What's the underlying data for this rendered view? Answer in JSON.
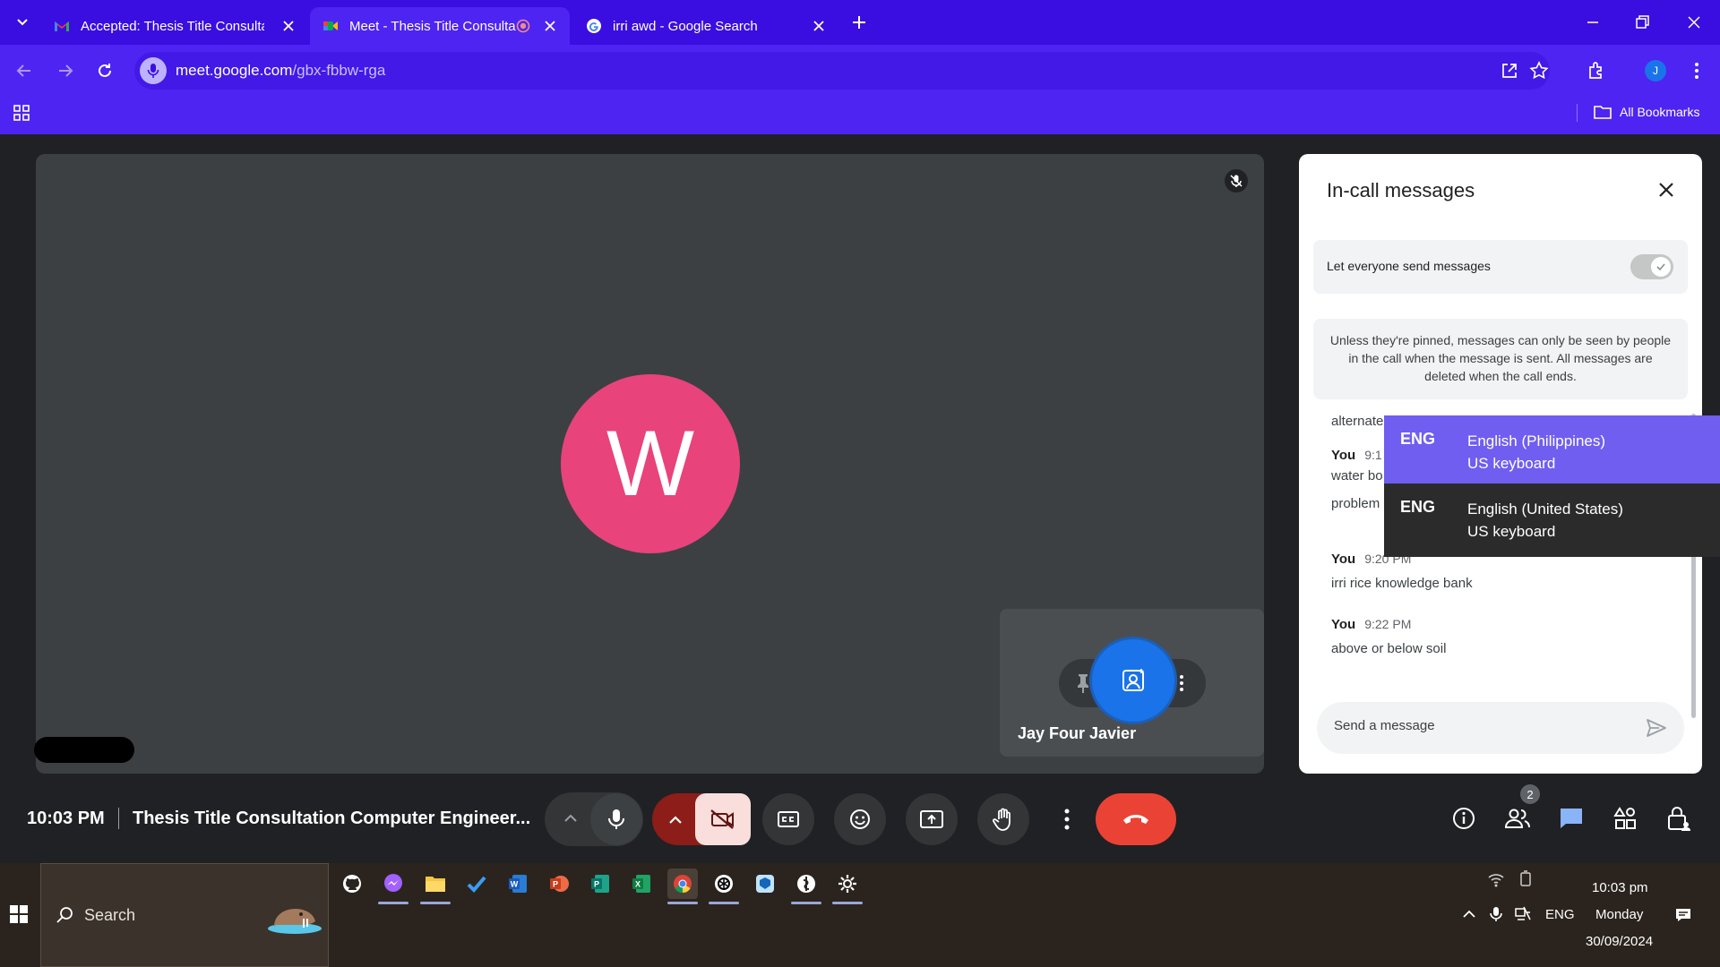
{
  "browser": {
    "tabs": [
      {
        "title": "Accepted: Thesis Title Consultat",
        "active": false
      },
      {
        "title": "Meet - Thesis Title Consulta",
        "active": true
      },
      {
        "title": "irri awd - Google Search",
        "active": false
      }
    ],
    "url_host": "meet.google.com",
    "url_path": "/gbx-fbbw-rga",
    "profile_initial": "J",
    "bookmarks_label": "All Bookmarks"
  },
  "meeting": {
    "main_avatar_letter": "W",
    "self_tile_name": "Jay Four Javier",
    "clock": "10:03 PM",
    "separator": "|",
    "title": "Thesis Title Consultation Computer Engineer...",
    "participants_count": "2"
  },
  "chat_panel": {
    "title": "In-call messages",
    "toggle_label": "Let everyone send messages",
    "toggle_on": true,
    "info_text": "Unless they're pinned, messages can only be seen by people in the call when the message is sent. All messages are deleted when the call ends.",
    "messages": [
      {
        "sender": "",
        "time": "",
        "text": "alternate"
      },
      {
        "sender": "You",
        "time": "9:1",
        "text": "water bo"
      },
      {
        "sender": "",
        "time": "",
        "text": "problem"
      },
      {
        "sender": "You",
        "time": "9:20 PM",
        "text": "irri rice knowledge bank"
      },
      {
        "sender": "You",
        "time": "9:22 PM",
        "text": "above or below soil"
      }
    ],
    "input_placeholder": "Send a message"
  },
  "language_flyout": {
    "items": [
      {
        "code": "ENG",
        "language": "English (Philippines)",
        "keyboard": "US keyboard",
        "selected": true
      },
      {
        "code": "ENG",
        "language": "English (United States)",
        "keyboard": "US keyboard",
        "selected": false
      }
    ]
  },
  "taskbar": {
    "search_label": "Search",
    "time": "10:03 pm",
    "day": "Monday",
    "date": "30/09/2024",
    "language": "ENG"
  },
  "colors": {
    "browser_accent": "#4e24f2",
    "avatar": "#e8437a",
    "end_call": "#ea4335",
    "selected_language": "#6f5ef0"
  }
}
